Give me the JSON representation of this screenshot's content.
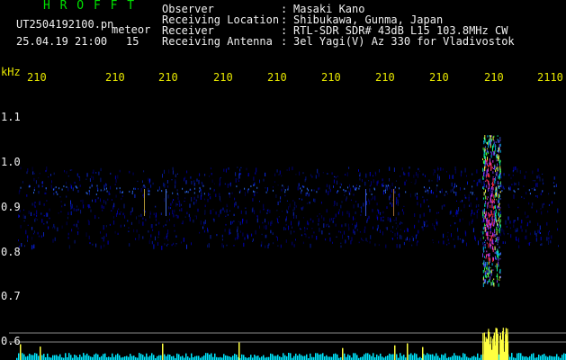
{
  "brand": "HROFFT",
  "file": {
    "name": "UT2504192100.pn",
    "type": "meteor"
  },
  "timestamp": "25.04.19 21:00",
  "count": "15",
  "header": [
    {
      "key": "Observer",
      "value": "Masaki Kano"
    },
    {
      "key": "Receiving Location",
      "value": "Shibukawa, Gunma, Japan"
    },
    {
      "key": "Receiver",
      "value": "RTL-SDR SDR# 43dB L15 103.8MHz CW"
    },
    {
      "key": "Receiving Antenna",
      "value": "3el Yagi(V) Az 330 for Vladivostok"
    }
  ],
  "axis": {
    "x_unit": "kHz",
    "x_ticks": [
      "210",
      "210",
      "210",
      "210",
      "210",
      "210",
      "210",
      "210",
      "210",
      "2110"
    ],
    "y_ticks": [
      "1.1",
      "1.0",
      "0.9",
      "0.8",
      "0.7",
      "0.6"
    ]
  },
  "colors": {
    "label": "#00e000",
    "text": "#f0f0f0",
    "tick": "#e8e800",
    "signal": "#0000c8",
    "meteor": "#ff4040",
    "level": "#00e8ff"
  }
}
